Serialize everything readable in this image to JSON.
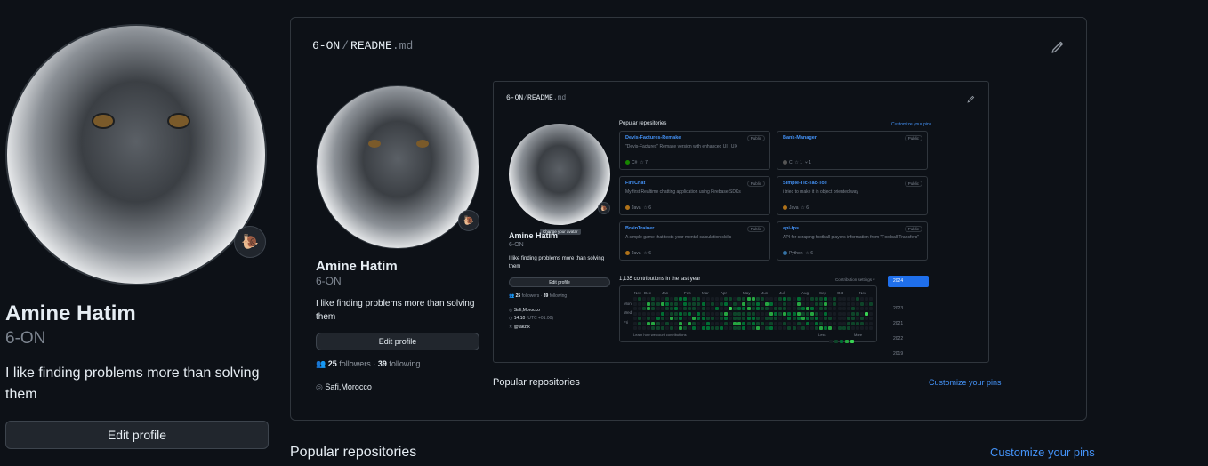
{
  "profile": {
    "name": "Amine Hatim",
    "login": "6-ON",
    "bio": "I like finding problems more than solving them",
    "edit_label": "Edit profile",
    "status_emoji": "🐌",
    "followers_count": "25",
    "followers_label": "followers",
    "following_count": "39",
    "following_label": "following",
    "separator": "·",
    "location": "Safi,Morocco"
  },
  "readme": {
    "owner": "6-ON",
    "slash": "/",
    "file": "README",
    "ext": ".md"
  },
  "inner": {
    "popular_label": "Popular repositories",
    "customize_label": "Customize your pins",
    "avatar_tooltip": "Change your avatar",
    "time_value": "14:10",
    "time_tz": "(UTC +01:00)",
    "twitter": "@takztk",
    "repos": [
      {
        "name": "Devis-Factures-Remake",
        "badge": "Public",
        "desc": "\"Devis-Factures\" Remake version with enhanced UI , UX",
        "lang": "C#",
        "color": "#178600",
        "stars": "7",
        "forks": ""
      },
      {
        "name": "Bank-Manager",
        "badge": "Public",
        "desc": "",
        "lang": "C",
        "color": "#555555",
        "stars": "1",
        "forks": "1"
      },
      {
        "name": "FireChat",
        "badge": "Public",
        "desc": "My first Realtime chatting application using Firebase SDKs",
        "lang": "Java",
        "color": "#b07219",
        "stars": "6",
        "forks": ""
      },
      {
        "name": "Simple-Tic-Tac-Toe",
        "badge": "Public",
        "desc": "i tried to make it in object oriented way",
        "lang": "Java",
        "color": "#b07219",
        "stars": "6",
        "forks": ""
      },
      {
        "name": "BrainTrainer",
        "badge": "Public",
        "desc": "A simple game that tests your mental calculation skills",
        "lang": "Java",
        "color": "#b07219",
        "stars": "6",
        "forks": ""
      },
      {
        "name": "api-fps",
        "badge": "Public",
        "desc": "API for scraping football players information from \"Football Transfers\"",
        "lang": "Python",
        "color": "#3572A5",
        "stars": "6",
        "forks": ""
      }
    ],
    "contrib_title": "1,135 contributions in the last year",
    "contrib_settings": "Contribution settings ▾",
    "months": [
      "Nov",
      "Dec",
      "Jan",
      "Feb",
      "Mar",
      "Apr",
      "May",
      "Jun",
      "Jul",
      "Aug",
      "Sep",
      "Oct",
      "Nov"
    ],
    "days": [
      "Mon",
      "Wed",
      "Fri"
    ],
    "learn_label": "Learn how we count contributions",
    "less_label": "Less",
    "more_label": "More",
    "years": [
      "2024",
      "2023",
      "2021",
      "2022",
      "2019"
    ]
  },
  "page": {
    "popular_label": "Popular repositories",
    "customize_label": "Customize your pins"
  },
  "colors": {
    "background": "#0d1117",
    "border": "#30363d",
    "accent": "#4493f8",
    "muted": "#7d8590"
  }
}
